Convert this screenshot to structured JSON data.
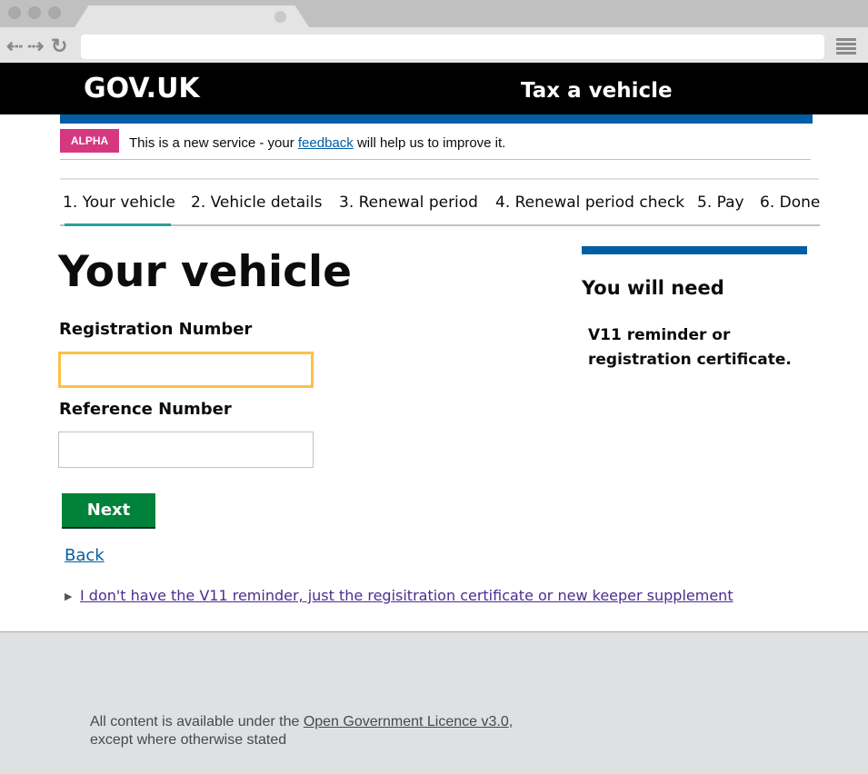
{
  "header": {
    "logo": "GOV.UK",
    "service_name": "Tax a vehicle"
  },
  "phase_banner": {
    "tag": "ALPHA",
    "text_before": "This is a new service - your ",
    "link": "feedback",
    "text_after": " will help us to improve it."
  },
  "steps": [
    {
      "label": "1. Your vehicle",
      "active": true
    },
    {
      "label": "2. Vehicle details"
    },
    {
      "label": "3. Renewal period"
    },
    {
      "label": "4. Renewal period check"
    },
    {
      "label": "5. Pay"
    },
    {
      "label": "6. Done"
    }
  ],
  "main": {
    "title": "Your vehicle",
    "registration_label": "Registration Number",
    "registration_value": "",
    "reference_label": "Reference Number",
    "reference_value": "",
    "next_label": "Next",
    "back_label": "Back",
    "details_link": "I don't have the V11 reminder, just the regisitration certificate or new keeper supplement"
  },
  "sidebar": {
    "heading": "You will need",
    "text": "V11 reminder or registration certificate."
  },
  "footer": {
    "text_before": "All content is available under the ",
    "link": "Open Government Licence v3.0",
    "text_after": ",",
    "line2": "except where otherwise stated"
  },
  "colors": {
    "header": "#000000",
    "accent": "#005ea5",
    "alpha": "#d53880",
    "button": "#00823b",
    "active_step": "#28a197",
    "focus": "#ffbf47"
  }
}
